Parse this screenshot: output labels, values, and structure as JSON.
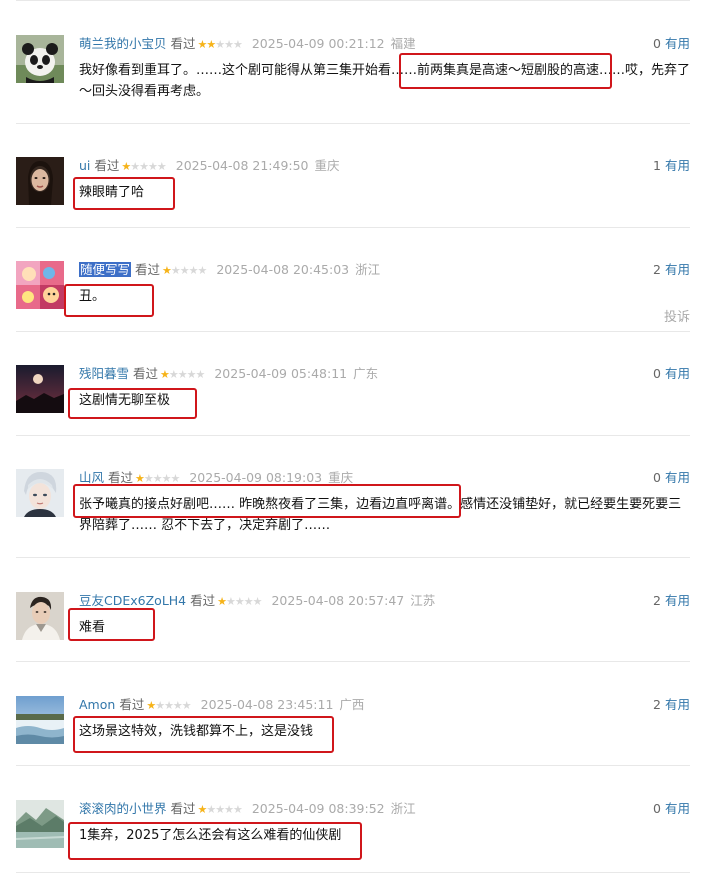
{
  "ui": {
    "watched_label": "看过",
    "useful_label": "有用",
    "report_label": "投诉"
  },
  "colors": {
    "link": "#3377aa",
    "highlight_box": "#d0161b",
    "star_on": "#f6b319",
    "star_off": "#d8d8d8",
    "meta_gray": "#aaaaaa"
  },
  "comments": [
    {
      "user": "萌兰我的小宝贝",
      "rating": 2,
      "stars_on": "★★",
      "stars_off": "★★★",
      "time": "2025-04-09 00:21:12",
      "location": "福建",
      "votes": "0",
      "text": "我好像看到重耳了。……这个剧可能得从第三集开始看……前两集真是高速～短剧股的高速……哎，先弃了～回头没得看再考虑。",
      "avatar_icon": "panda-avatar"
    },
    {
      "user": "ui",
      "rating": 1,
      "stars_on": "★",
      "stars_off": "★★★★",
      "time": "2025-04-08 21:49:50",
      "location": "重庆",
      "votes": "1",
      "text": "辣眼睛了哈",
      "avatar_icon": "woman-portrait-avatar"
    },
    {
      "user": "随便写写",
      "rating": 1,
      "stars_on": "★",
      "stars_off": "★★★★",
      "time": "2025-04-08 20:45:03",
      "location": "浙江",
      "votes": "2",
      "text": "丑。",
      "avatar_icon": "cartoon-collage-avatar"
    },
    {
      "user": "残阳暮雪",
      "rating": 1,
      "stars_on": "★",
      "stars_off": "★★★★",
      "time": "2025-04-09 05:48:11",
      "location": "广东",
      "votes": "0",
      "text": "这剧情无聊至极",
      "avatar_icon": "sunset-avatar"
    },
    {
      "user": "山风",
      "rating": 1,
      "stars_on": "★",
      "stars_off": "★★★★",
      "time": "2025-04-09 08:19:03",
      "location": "重庆",
      "votes": "0",
      "text": "张予曦真的接点好剧吧…… 昨晚熬夜看了三集，边看边直呼离谱。感情还没铺垫好，就已经要生要死要三界陪葬了…… 忍不下去了，决定弃剧了……",
      "avatar_icon": "anime-boy-avatar"
    },
    {
      "user": "豆友CDEx6ZoLH4",
      "rating": 1,
      "stars_on": "★",
      "stars_off": "★★★★",
      "time": "2025-04-08 20:57:47",
      "location": "江苏",
      "votes": "2",
      "text": "难看",
      "avatar_icon": "man-portrait-avatar"
    },
    {
      "user": "Amon",
      "rating": 1,
      "stars_on": "★",
      "stars_off": "★★★★",
      "time": "2025-04-08 23:45:11",
      "location": "广西",
      "votes": "2",
      "text": "这场景这特效，洗钱都算不上，这是没钱",
      "avatar_icon": "waterfall-avatar"
    },
    {
      "user": "滚滚肉的小世界",
      "rating": 1,
      "stars_on": "★",
      "stars_off": "★★★★",
      "time": "2025-04-09 08:39:52",
      "location": "浙江",
      "votes": "0",
      "text": "1集弃，2025了怎么还会有这么难看的仙侠剧",
      "avatar_icon": "lake-landscape-avatar"
    }
  ]
}
